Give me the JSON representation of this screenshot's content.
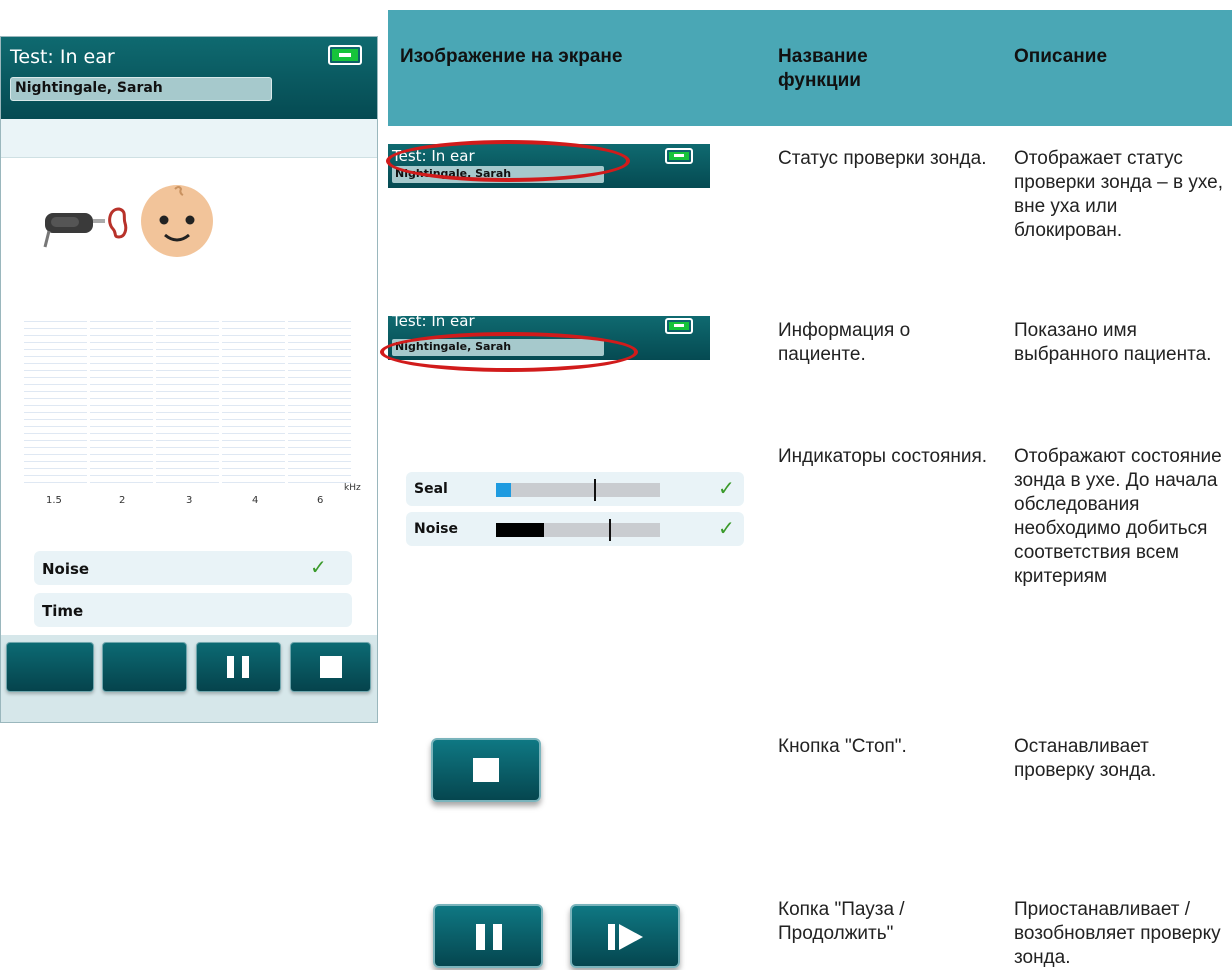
{
  "device": {
    "title": "Test: In ear",
    "patient": "Nightingale, Sarah",
    "freq_ticks": [
      "1.5",
      "2",
      "3",
      "4",
      "6"
    ],
    "freq_unit": "kHz",
    "status_rows": [
      {
        "label": "Noise",
        "ok": true
      },
      {
        "label": "Time",
        "ok": false
      }
    ],
    "battery_color": "#16c43a",
    "accent_header": "#0a5a62"
  },
  "table": {
    "headers": {
      "screen_image": "Изображение на экране",
      "function_name": "Название функции",
      "description": "Описание"
    },
    "rows": [
      {
        "name": "Статус проверки зонда.",
        "desc": "Отображает статус проверки зонда – в ухе, вне уха или блокирован."
      },
      {
        "name": "Информация о пациенте.",
        "desc": "Показано имя выбранного пациента."
      },
      {
        "name": "Индикаторы состояния.",
        "desc": "Отображают состояние зонда в ухе. До начала обследования необходимо добиться соответствия всем критериям"
      },
      {
        "name": "Кнопка \"Стоп\".",
        "desc": "Останавливает проверку зонда."
      },
      {
        "name": "Копка \"Пауза / Продолжить\"",
        "desc": "Приостанавливает / возобновляет проверку зонда."
      }
    ],
    "thumb1": {
      "title": "Test: In ear",
      "patient": "Nightingale, Sarah"
    },
    "thumb2": {
      "title": "Test: In ear",
      "patient": "Nightingale, Sarah"
    },
    "indicators": [
      {
        "label": "Seal",
        "level": 0.09,
        "threshold": 0.6,
        "color": "#1f9be0",
        "ok": true
      },
      {
        "label": "Noise",
        "level": 0.29,
        "threshold": 0.69,
        "color": "#000000",
        "ok": true
      }
    ],
    "check_glyph": "✓",
    "highlight_color": "#d11b1b"
  }
}
